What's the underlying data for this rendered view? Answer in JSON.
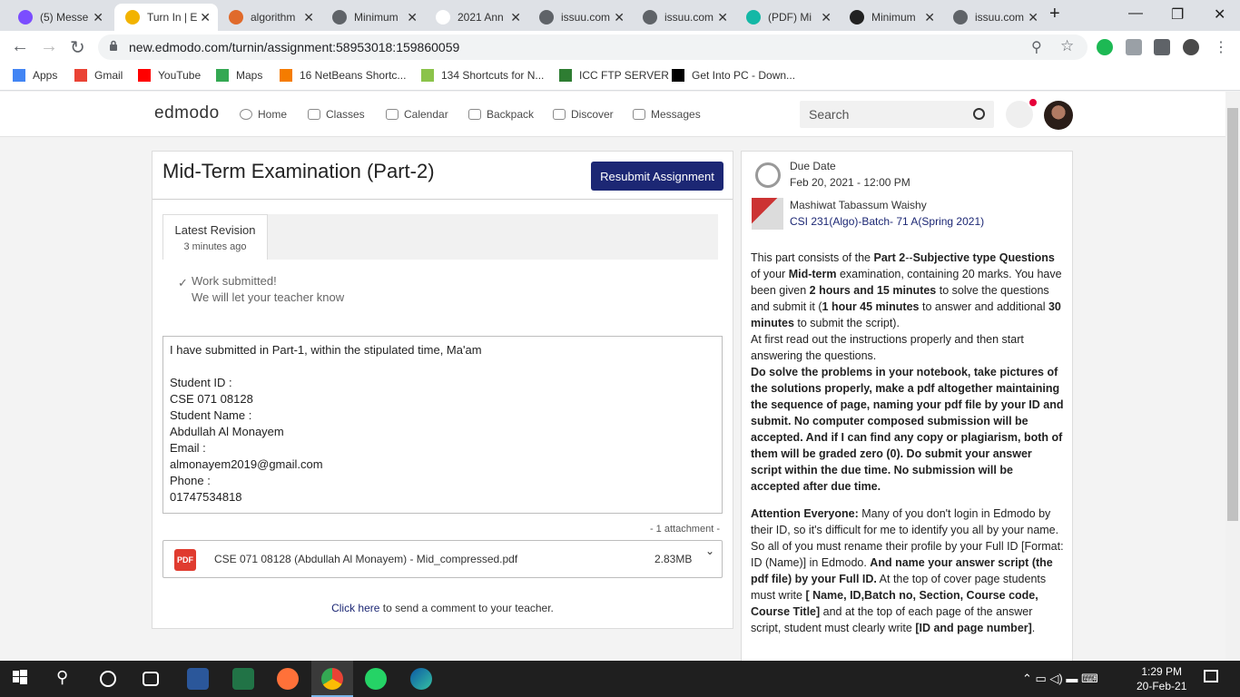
{
  "browser": {
    "tabs": [
      {
        "label": "(5) Messe",
        "icon": "messenger-icon",
        "color": "#7b4dff"
      },
      {
        "label": "Turn In | E",
        "icon": "edmodo-icon",
        "color": "#f2b300"
      },
      {
        "label": "algorithm",
        "icon": "algo-icon",
        "color": "#e06a2b"
      },
      {
        "label": "Minimum",
        "icon": "globe-icon",
        "color": "#5f6368"
      },
      {
        "label": "2021 Ann",
        "icon": "blank-icon",
        "color": "#ffffff"
      },
      {
        "label": "issuu.com",
        "icon": "globe-icon",
        "color": "#5f6368"
      },
      {
        "label": "issuu.com",
        "icon": "globe-icon",
        "color": "#5f6368"
      },
      {
        "label": "(PDF) Mi",
        "icon": "researchgate-icon",
        "color": "#14b8a6"
      },
      {
        "label": "Minimum",
        "icon": "wikipedia-icon",
        "color": "#222222"
      },
      {
        "label": "issuu.com",
        "icon": "globe-icon",
        "color": "#5f6368"
      }
    ],
    "close_glyph": "✕",
    "new_tab_glyph": "+",
    "url": "new.edmodo.com/turnin/assignment:58953018:159860059",
    "bookmarks": [
      {
        "label": "Apps",
        "icon": "apps-icon",
        "color": "#4285f4"
      },
      {
        "label": "Gmail",
        "icon": "gmail-icon",
        "color": "#ea4335"
      },
      {
        "label": "YouTube",
        "icon": "youtube-icon",
        "color": "#ff0000"
      },
      {
        "label": "Maps",
        "icon": "maps-icon",
        "color": "#34a853"
      },
      {
        "label": "16 NetBeans Shortc...",
        "icon": "javatpoint-icon",
        "color": "#f57c00"
      },
      {
        "label": "134 Shortcuts for N...",
        "icon": "shortcut-icon",
        "color": "#8bc34a"
      },
      {
        "label": "ICC FTP SERVER",
        "icon": "ftp-icon",
        "color": "#2e7d32"
      },
      {
        "label": "Get Into PC - Down...",
        "icon": "getintopc-icon",
        "color": "#000000"
      }
    ]
  },
  "edmodo": {
    "logo": "edmodo",
    "nav": [
      "Home",
      "Classes",
      "Calendar",
      "Backpack",
      "Discover",
      "Messages"
    ],
    "search_placeholder": "Search"
  },
  "assignment": {
    "title": "Mid-Term Examination (Part-2)",
    "resubmit_label": "Resubmit Assignment",
    "revision_label": "Latest Revision",
    "revision_time": "3 minutes ago",
    "work_line1": "Work submitted!",
    "work_line2": "We will let your teacher know",
    "comment_lines": [
      "I have submitted in Part-1, within the stipulated time, Ma'am",
      "",
      "Student ID :",
      "CSE 071 08128",
      "Student Name :",
      "Abdullah Al Monayem",
      "Email :",
      "almonayem2019@gmail.com",
      "Phone :",
      "01747534818"
    ],
    "attachment_count": "- 1 attachment -",
    "attachment_type": "PDF",
    "attachment_name": "CSE 071 08128 (Abdullah Al Monayem) - Mid_compressed.pdf",
    "attachment_size": "2.83MB",
    "send_comment_link": "Click here",
    "send_comment_rest": " to send a comment to your teacher."
  },
  "details": {
    "due_label": "Due Date",
    "due_date": "Feb 20, 2021 - 12:00 PM",
    "teacher": "Mashiwat Tabassum Waishy",
    "course": "CSI 231(Algo)-Batch- 71 A(Spring 2021)"
  },
  "taskbar": {
    "time": "1:29 PM",
    "date": "20-Feb-21"
  }
}
